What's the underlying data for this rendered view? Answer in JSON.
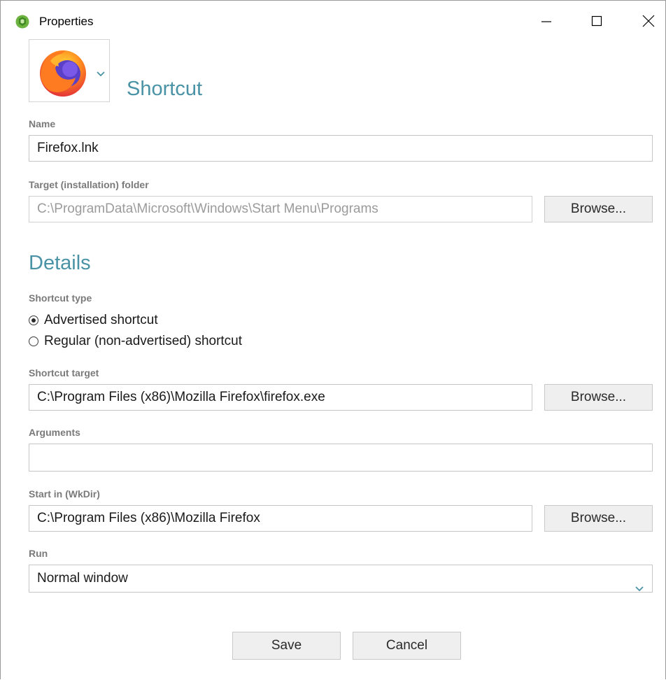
{
  "window": {
    "title": "Properties",
    "icon": "app-logo-icon"
  },
  "header": {
    "heading": "Shortcut",
    "icon": "firefox-icon"
  },
  "name": {
    "label": "Name",
    "value": "Firefox.lnk"
  },
  "target_folder": {
    "label": "Target (installation) folder",
    "value": "C:\\ProgramData\\Microsoft\\Windows\\Start Menu\\Programs",
    "browse_label": "Browse..."
  },
  "details": {
    "heading": "Details",
    "shortcut_type": {
      "label": "Shortcut  type",
      "options": [
        {
          "label": "Advertised shortcut",
          "selected": true
        },
        {
          "label": "Regular (non-advertised) shortcut",
          "selected": false
        }
      ]
    },
    "shortcut_target": {
      "label": "Shortcut target",
      "value": "C:\\Program Files (x86)\\Mozilla Firefox\\firefox.exe",
      "browse_label": "Browse..."
    },
    "arguments": {
      "label": "Arguments",
      "value": ""
    },
    "start_in": {
      "label": "Start in (WkDir)",
      "value": "C:\\Program Files (x86)\\Mozilla Firefox",
      "browse_label": "Browse..."
    },
    "run": {
      "label": "Run",
      "value": "Normal window"
    }
  },
  "footer": {
    "save_label": "Save",
    "cancel_label": "Cancel"
  },
  "colors": {
    "accent": "#4a93a6",
    "label_gray": "#7a7a7a",
    "button_bg": "#efefef"
  }
}
